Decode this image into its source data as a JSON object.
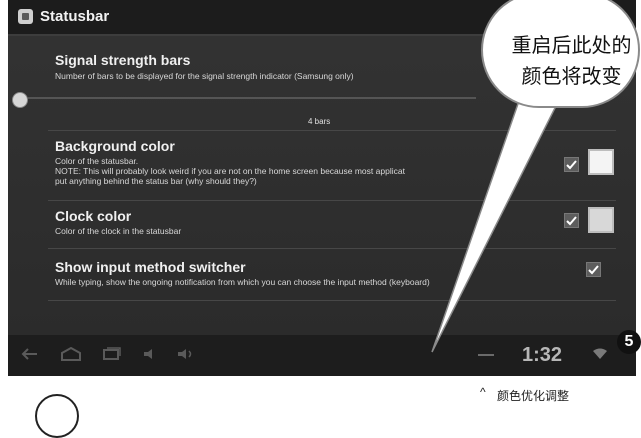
{
  "app": {
    "title": "Statusbar"
  },
  "preferences": [
    {
      "title": "Signal strength bars",
      "summary": "Number of bars to be displayed for the signal strength indicator (Samsung only)"
    },
    {
      "title": "Background color",
      "summary": "Color of the statusbar.",
      "note_line1": "NOTE: This will probably look weird if you are not on the home screen because most applicat",
      "note_line2": "put anything behind the status bar (why should they?)",
      "checked": true
    },
    {
      "title": "Clock color",
      "summary": "Color of the clock in the statusbar",
      "checked": true
    },
    {
      "title": "Show input method switcher",
      "summary": "While typing, show the ongoing notification from which you can choose the input method (keyboard)",
      "checked": true
    }
  ],
  "slider": {
    "value_label": "4 bars"
  },
  "navbar": {
    "clock": "1:32"
  },
  "annotation": {
    "callout_line1": "重启后此处的",
    "callout_line2": "颜色将改变",
    "step_number": "5",
    "caption": "颜色优化调整",
    "caption_mark": "^"
  }
}
